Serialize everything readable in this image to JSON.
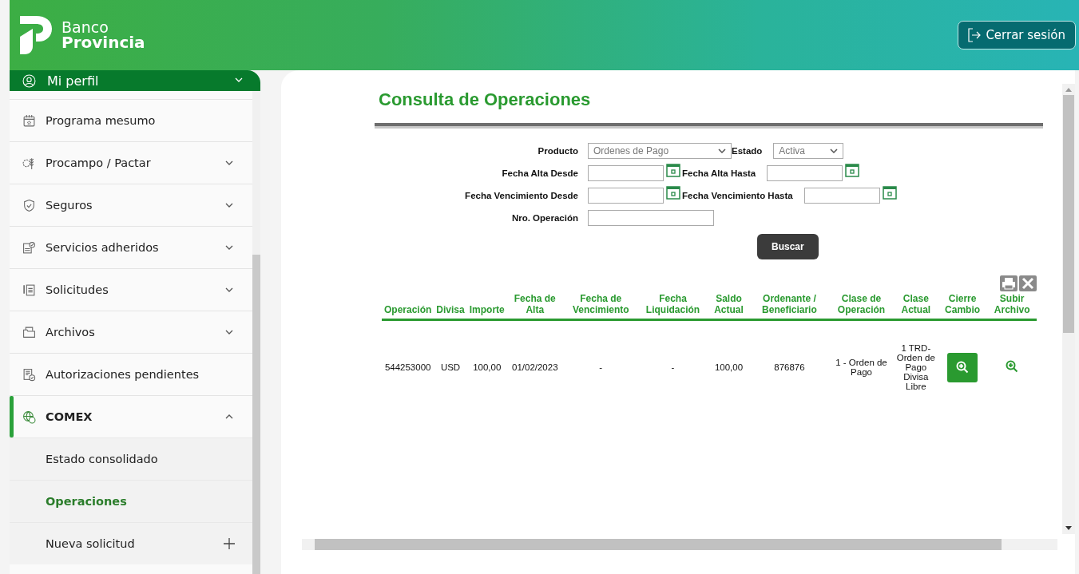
{
  "header": {
    "logo": {
      "line1": "Banco",
      "line2": "Provincia"
    },
    "logout_button": "Cerrar sesión"
  },
  "sidebar": {
    "profile": {
      "label": "Mi perfil",
      "expanded": false
    },
    "items": [
      {
        "label": "Programa mesumo",
        "kind": "link"
      },
      {
        "label": "Procampo / Pactar",
        "kind": "group",
        "expanded": false,
        "selected": false
      },
      {
        "label": "Seguros",
        "kind": "group",
        "expanded": false,
        "selected": false
      },
      {
        "label": "Servicios adheridos",
        "kind": "group",
        "expanded": false,
        "selected": false
      },
      {
        "label": "Solicitudes",
        "kind": "group",
        "expanded": false,
        "selected": false
      },
      {
        "label": "Archivos",
        "kind": "group",
        "expanded": false,
        "selected": false
      },
      {
        "label": "Autorizaciones pendientes",
        "kind": "link"
      },
      {
        "label": "COMEX",
        "kind": "group",
        "expanded": true,
        "selected": true,
        "children": [
          {
            "label": "Estado consolidado",
            "kind": "link",
            "selected": false
          },
          {
            "label": "Operaciones",
            "kind": "link",
            "selected": true
          },
          {
            "label": "Nueva solicitud",
            "kind": "add",
            "selected": false
          }
        ]
      }
    ]
  },
  "main": {
    "title": "Consulta de Operaciones",
    "form": [
      [
        {
          "label": "Producto",
          "kind": "select",
          "value": "Ordenes de Pago"
        },
        {
          "label": "Estado",
          "kind": "select",
          "value": "Activa"
        }
      ],
      [
        {
          "label": "Fecha Alta Desde",
          "kind": "date"
        },
        {
          "label": "Fecha Alta Hasta",
          "kind": "date"
        }
      ],
      [
        {
          "label": "Fecha Vencimiento Desde",
          "kind": "date"
        },
        {
          "label": "Fecha Vencimiento Hasta",
          "kind": "date"
        }
      ],
      [
        {
          "label": "Nro. Operación",
          "kind": "text"
        }
      ]
    ],
    "search_button": "Buscar",
    "table": {
      "columns": [
        "Operación",
        "Divisa",
        "Importe",
        "Fecha de Alta",
        "Fecha de Vencimiento",
        "Fecha Liquidación",
        "Saldo Actual",
        "Ordenante / Beneficiario",
        "Clase de Operación",
        "Clase Actual",
        "Cierre Cambio",
        "Subir Archivo"
      ],
      "rows": [
        {
          "cells": [
            "544253000",
            "USD",
            "100,00",
            "01/02/2023",
            "-",
            "-",
            "100,00",
            "876876",
            "1 - Orden de Pago",
            "1 TRD-Orden de Pago Divisa Libre"
          ],
          "actions": [
            {
              "kind": "filled"
            },
            {
              "kind": "plain"
            }
          ]
        }
      ]
    }
  }
}
